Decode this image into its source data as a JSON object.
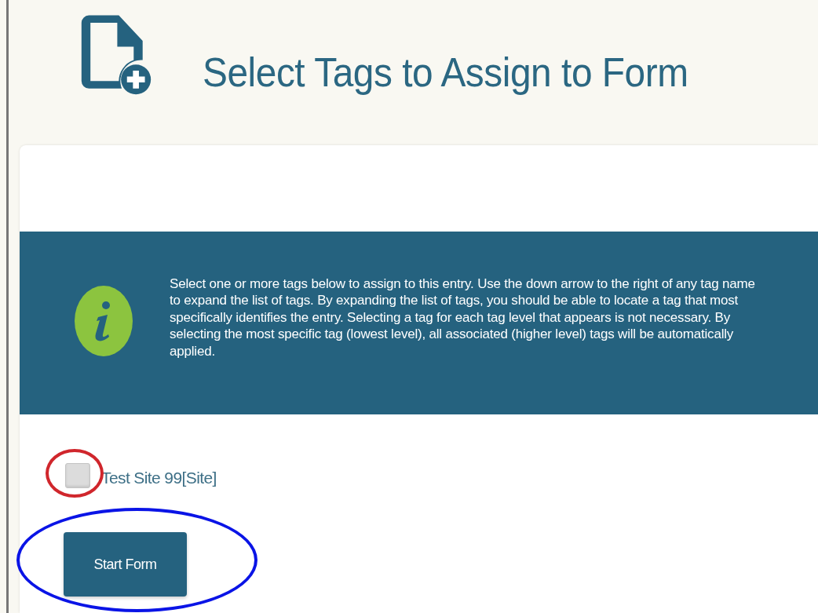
{
  "header": {
    "title": "Select Tags to Assign to Form"
  },
  "info_banner": {
    "text": "Select one or more tags below to assign to this entry. Use the down arrow to the right of any tag name to expand the list of tags. By expanding the list of tags, you should be able to locate a tag that most specifically identifies the entry. Selecting a tag for each tag level that appears is not necessary. By selecting the most specific tag (lowest level), all associated (higher level) tags will be automatically applied."
  },
  "tags": [
    {
      "label": "Test Site 99[Site]",
      "checked": false,
      "annotation": {
        "kind": "ellipse",
        "color": "#d0262c"
      }
    }
  ],
  "start_button": {
    "label": "Start Form",
    "annotation": {
      "kind": "ellipse",
      "color": "#0a14e6"
    }
  }
}
